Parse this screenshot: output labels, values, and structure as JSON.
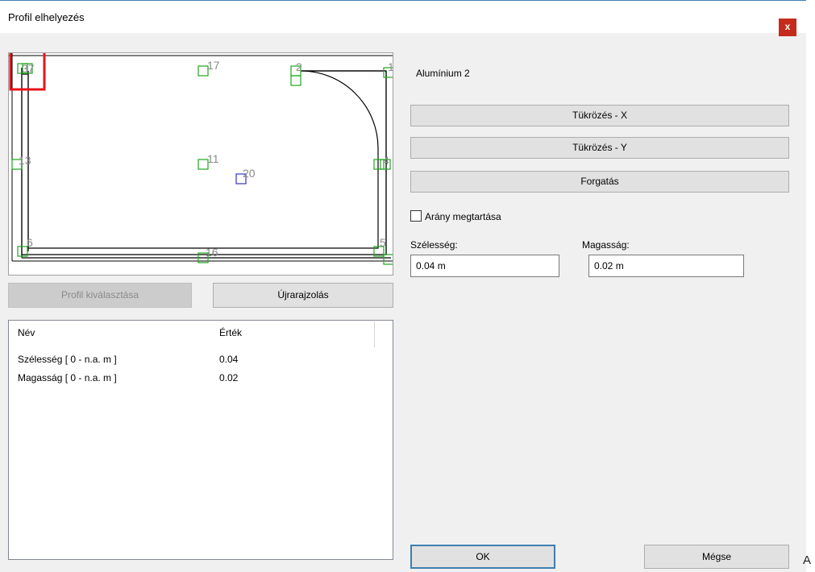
{
  "dialog": {
    "title": "Profil elhelyezés",
    "close_glyph": "x"
  },
  "preview": {
    "selection_color": "#e8141a",
    "marker_color": "#1ea51e",
    "selected_marker_color": "#3232c8",
    "node_labels": [
      "37",
      "17",
      "2",
      "13",
      "11",
      "20",
      "6",
      "16",
      "5",
      "1",
      "4"
    ]
  },
  "buttons": {
    "select_profile": "Profil kiválasztása",
    "redraw": "Újrarajzolás",
    "mirror_x": "Tükrözés - X",
    "mirror_y": "Tükrözés - Y",
    "rotate": "Forgatás",
    "ok": "OK",
    "cancel": "Mégse"
  },
  "grid": {
    "col_name": "Név",
    "col_value": "Érték",
    "rows": [
      {
        "name": "Szélesség [ 0 - n.a. m ]",
        "value": "0.04"
      },
      {
        "name": "Magasság [ 0 - n.a. m ]",
        "value": "0.02"
      }
    ]
  },
  "properties": {
    "profile_name": "Alumínium 2",
    "keep_ratio_label": "Arány megtartása",
    "width_label": "Szélesség:",
    "width_value": "0.04 m",
    "height_label": "Magasság:",
    "height_value": "0.02 m"
  },
  "outside_text": "A"
}
